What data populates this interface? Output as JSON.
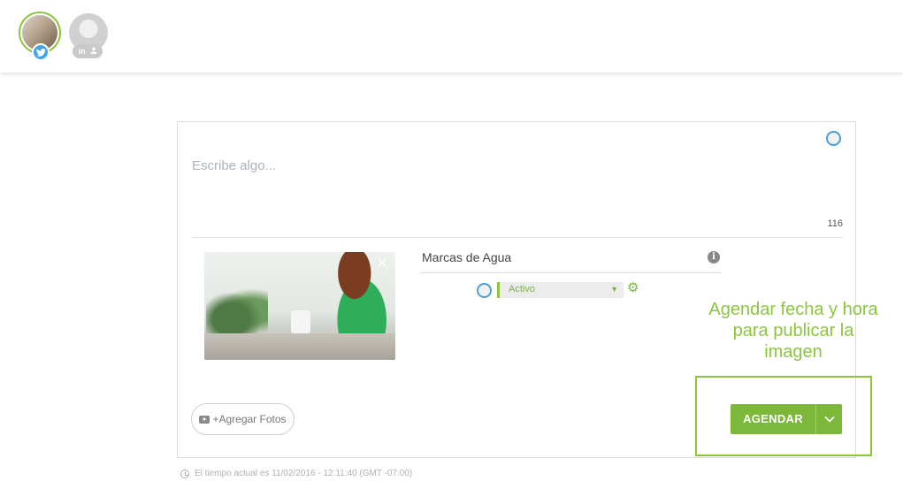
{
  "accounts": [
    {
      "network": "twitter",
      "selected": true,
      "icon": "twitter-bird-icon"
    },
    {
      "network": "linkedin",
      "selected": false,
      "badge_text": "in"
    }
  ],
  "composer": {
    "placeholder": "Escribe algo...",
    "char_count": "116"
  },
  "watermark": {
    "title": "Marcas de Agua",
    "selected_option": "Activo"
  },
  "add_photos_label": "+Agregar Fotos",
  "schedule_button_label": "AGENDAR",
  "annotation": {
    "line1": "Agendar  fecha y hora",
    "line2": "para publicar la",
    "line3": "imagen"
  },
  "current_time_text": "El tiempo actual es 11/02/2016 - 12:11:40 (GMT -07:00)",
  "colors": {
    "accent_green": "#7cb83a",
    "twitter_blue": "#3ea6e7"
  }
}
